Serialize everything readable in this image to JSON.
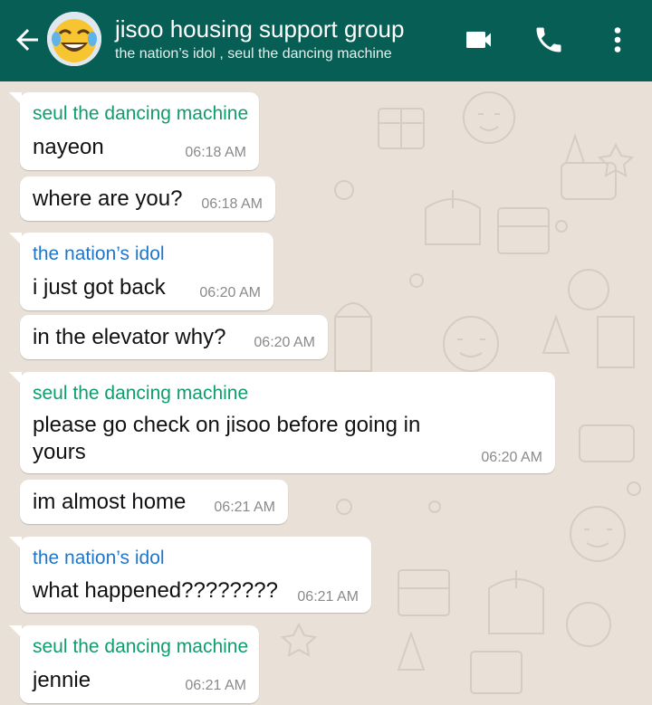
{
  "header": {
    "title": "jisoo housing support group",
    "subtitle": "the nation’s idol , seul the dancing machine"
  },
  "colors": {
    "header_bg": "#075e54",
    "sender_green": "#0f9d6b",
    "sender_blue": "#1e76c9",
    "wallpaper": "#e9e1d7"
  },
  "messages": [
    {
      "sender": "seul the dancing machine",
      "sender_color": "#0f9d6b",
      "text": "nayeon",
      "time": "06:18 AM"
    },
    {
      "sender": "",
      "text": "where are you?",
      "time": "06:18 AM"
    },
    {
      "sender": "the nation’s idol",
      "sender_color": "#1e76c9",
      "text": "i just got back",
      "time": "06:20 AM"
    },
    {
      "sender": "",
      "text": "in the elevator why?",
      "time": "06:20 AM"
    },
    {
      "sender": "seul the dancing machine",
      "sender_color": "#0f9d6b",
      "text": "please go check on jisoo before going in yours",
      "time": "06:20 AM"
    },
    {
      "sender": "",
      "text": "im almost home",
      "time": "06:21 AM"
    },
    {
      "sender": "the nation’s idol",
      "sender_color": "#1e76c9",
      "text": "what happened????????",
      "time": "06:21 AM"
    },
    {
      "sender": "seul the dancing machine",
      "sender_color": "#0f9d6b",
      "text": "jennie",
      "time": "06:21 AM"
    }
  ],
  "icons": {
    "back": "arrow-left-icon",
    "avatar": "laughing-emoji-avatar",
    "video": "video-camera-icon",
    "call": "phone-icon",
    "menu": "more-vertical-icon"
  }
}
